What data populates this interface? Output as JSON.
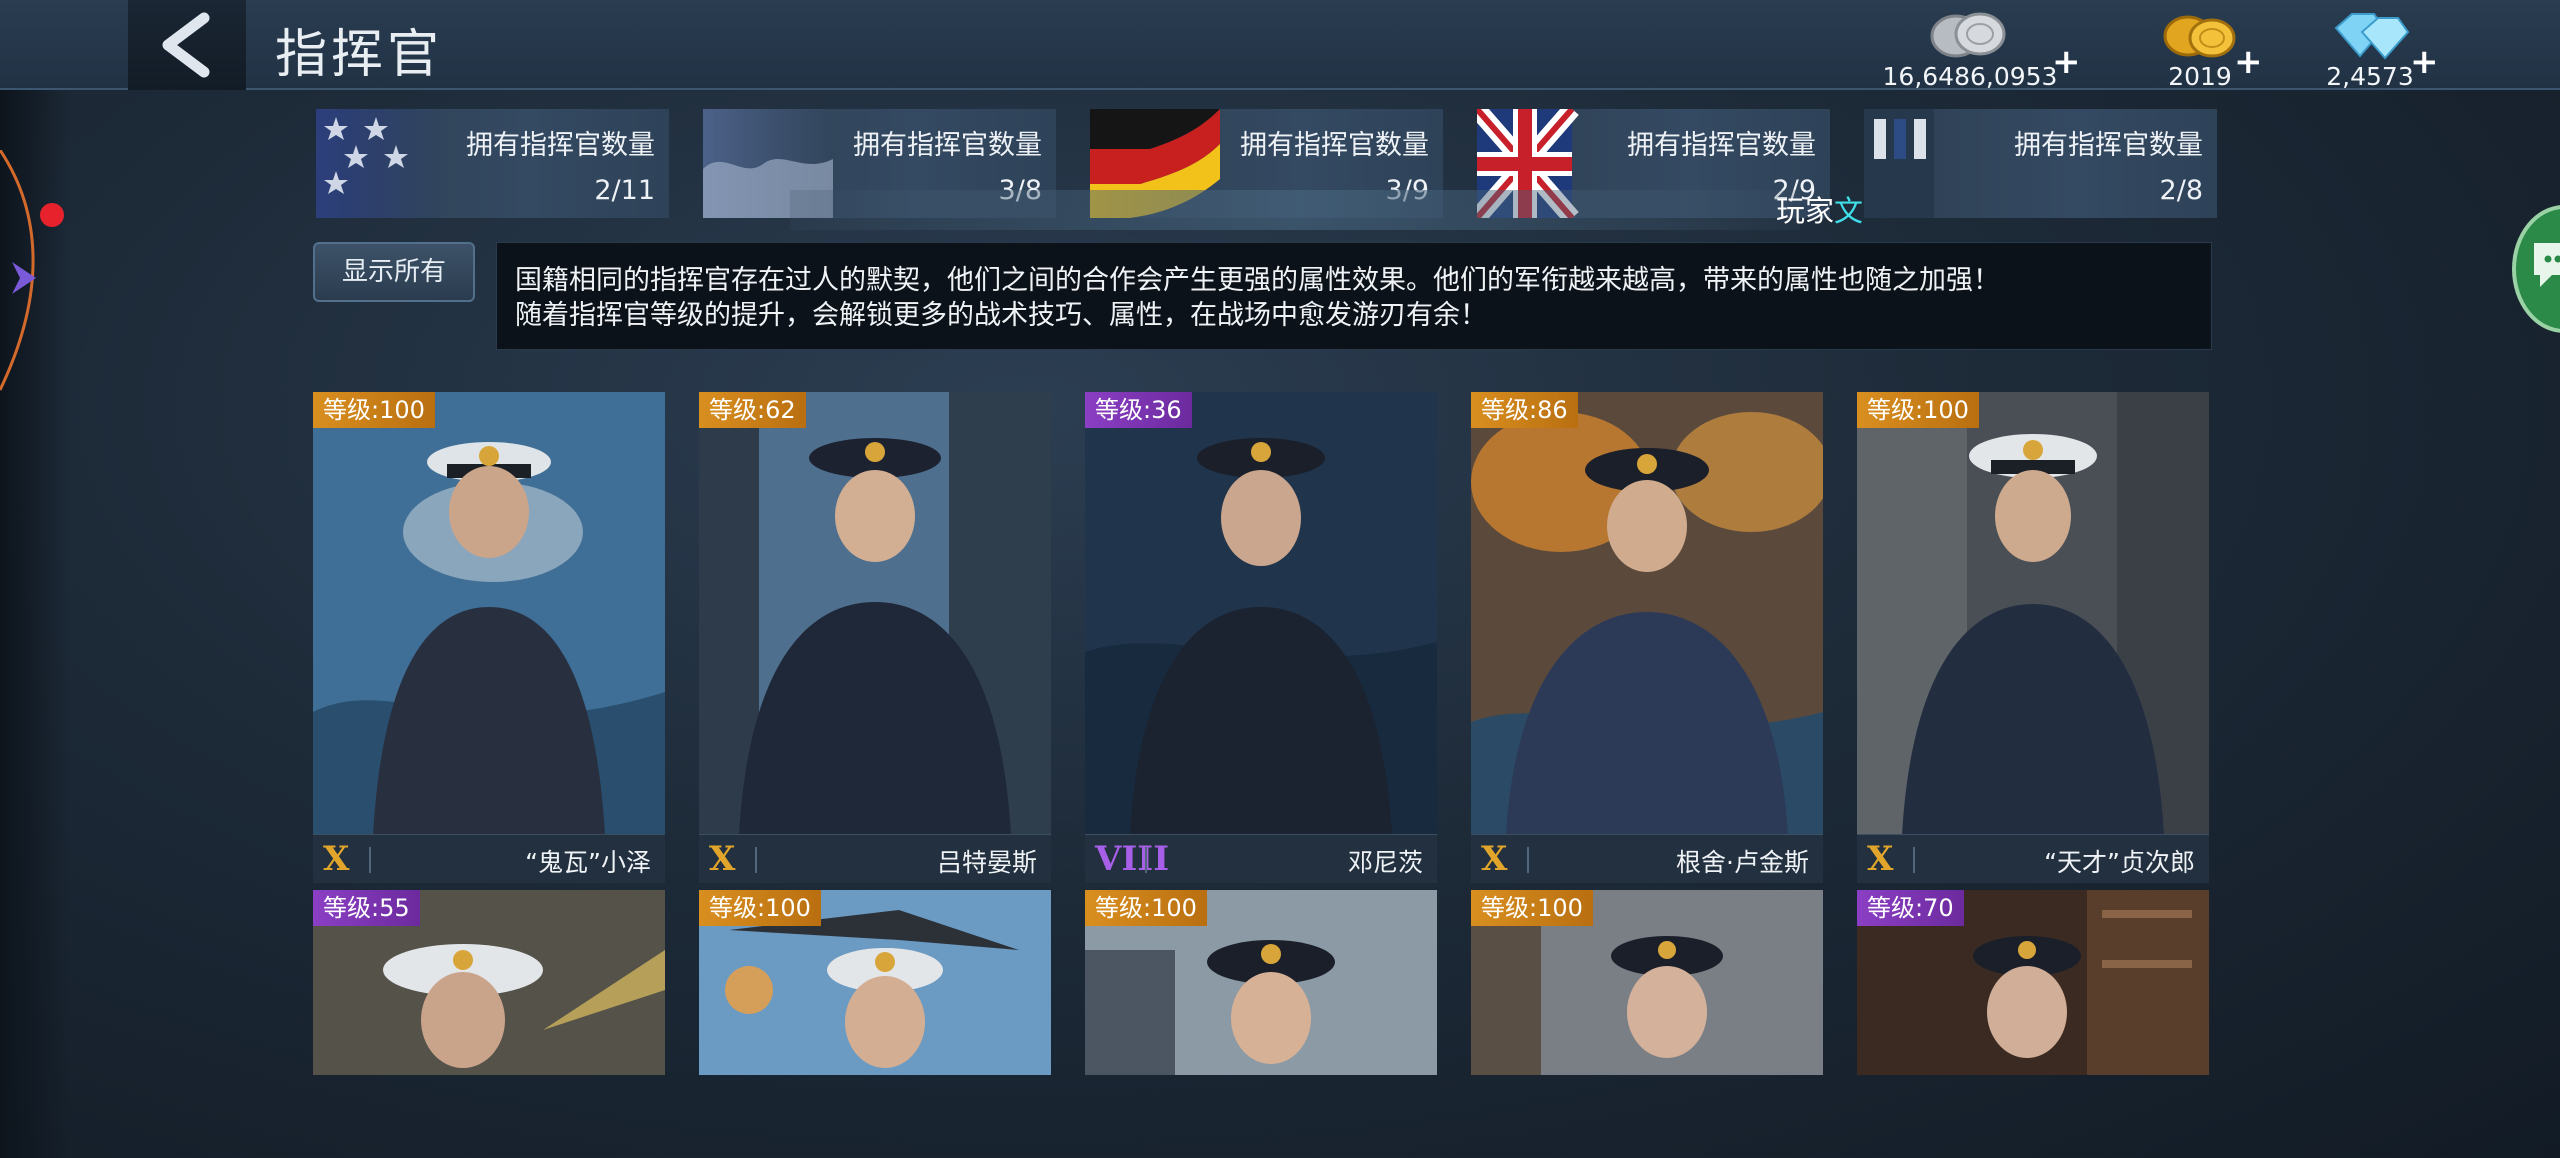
{
  "header": {
    "title": "指挥官",
    "currencies": [
      {
        "name": "silver-coins",
        "value": "16,6486,0953",
        "plus": "+"
      },
      {
        "name": "gold-coins",
        "value": "2019",
        "plus": "+"
      },
      {
        "name": "diamonds",
        "value": "2,4573",
        "plus": "+"
      }
    ]
  },
  "nations": [
    {
      "flag": "usa",
      "label": "拥有指挥官数量",
      "count": "2/11"
    },
    {
      "flag": "japan",
      "label": "拥有指挥官数量",
      "count": "3/8"
    },
    {
      "flag": "germany",
      "label": "拥有指挥官数量",
      "count": "3/9"
    },
    {
      "flag": "uk",
      "label": "拥有指挥官数量",
      "count": "2/9"
    },
    {
      "flag": "other",
      "label": "拥有指挥官数量",
      "count": "2/8"
    }
  ],
  "player_tag": {
    "text": "玩家",
    "accent": "文"
  },
  "filter": {
    "show_all_label": "显示所有"
  },
  "info": {
    "line1": "国籍相同的指挥官存在过人的默契，他们之间的合作会产生更强的属性效果。他们的军衔越来越高，带来的属性也随之加强！",
    "line2": "随着指挥官等级的提升，会解锁更多的战术技巧、属性，在战场中愈发游刃有余！"
  },
  "commanders_row1": [
    {
      "level": "等级:100",
      "rank": "X",
      "name": "“鬼瓦”小泽",
      "tier": "gold"
    },
    {
      "level": "等级:62",
      "rank": "X",
      "name": "吕特晏斯",
      "tier": "gold"
    },
    {
      "level": "等级:36",
      "rank": "VIII",
      "name": "邓尼茨",
      "tier": "purple"
    },
    {
      "level": "等级:86",
      "rank": "X",
      "name": "根舍·卢金斯",
      "tier": "gold"
    },
    {
      "level": "等级:100",
      "rank": "X",
      "name": "“天才”贞次郎",
      "tier": "gold"
    }
  ],
  "commanders_row2": [
    {
      "level": "等级:55",
      "tier": "purple"
    },
    {
      "level": "等级:100",
      "tier": "gold"
    },
    {
      "level": "等级:100",
      "tier": "gold"
    },
    {
      "level": "等级:100",
      "tier": "gold"
    },
    {
      "level": "等级:70",
      "tier": "purple"
    }
  ],
  "colors": {
    "accent_gold": "#d98f1f",
    "accent_purple": "#8b3fc4",
    "alert_red": "#e8222d",
    "player_cyan": "#3fe0ea"
  }
}
